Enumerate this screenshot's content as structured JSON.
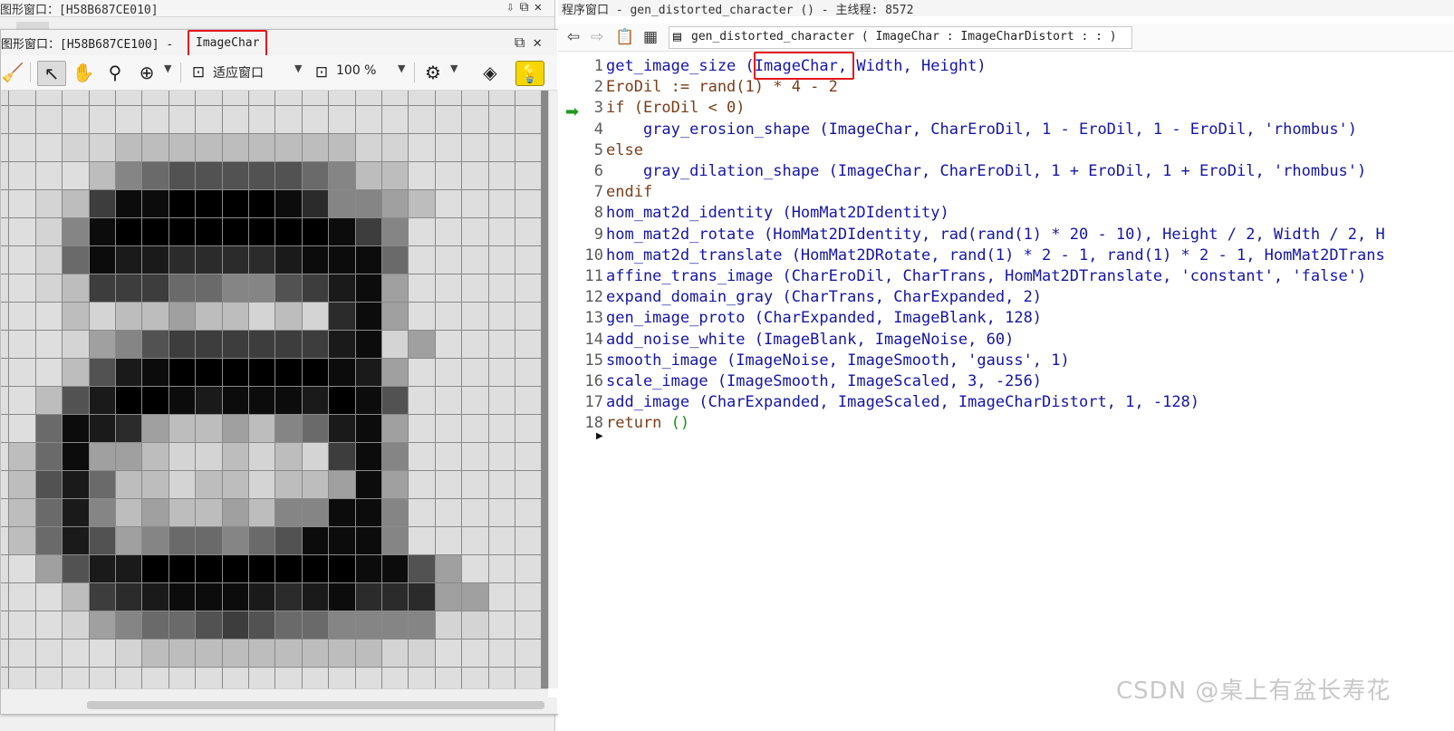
{
  "background_window": {
    "title": "图形窗口：[H58B687CE010]",
    "controls": [
      "⇩",
      "⧉",
      "✕"
    ]
  },
  "graphics_window": {
    "title_prefix": "图形窗口：[H58B687CE100] -",
    "image_name": "ImageChar",
    "zoom_fit_label": "适应窗口",
    "zoom_percent": "100 %",
    "controls": [
      "⧉",
      "✕"
    ]
  },
  "pixel_image": {
    "rows": 22,
    "cols": 21,
    "palette": [
      "#000000",
      "#0c0c0c",
      "#1a1a1a",
      "#2b2b2b",
      "#3d3d3d",
      "#525252",
      "#6a6a6a",
      "#858585",
      "#a0a0a0",
      "#bdbdbd",
      "#d4d4d4",
      "#dedede"
    ],
    "gray": [
      "bbbbbbbbbbbbbbbbbbbbb",
      "bbbbbbbbbbbbbbbbbbbbb",
      "bbbaa999999999aabbbbb",
      "bbbb976555556799bbbbb",
      "bba94110000137789bbbb",
      "bba7100000000147bbbbb",
      "bba6122333321116bbbbb",
      "bba9444667754218bbbbb",
      "bbb9a99899a9a318bbbbb",
      "bbba87544444421a8bbbb",
      "bbb9521000000128bbbbb",
      "bb95200121112015bbbbb",
      "bb61238998976218bbbbb",
      "b961889aa9a9a417bbbbb",
      "b952699a99a99818bbbbb",
      "b962798998977117bbbbb",
      "b962587667651117bbbbb",
      "bb8522000000001158bbb",
      "bbb9432111232133388bb",
      "bbba8766545667777aabb",
      "bbbbba999999999aabbbb",
      "bbbbbbbbbbbbbbbbbbbbb"
    ]
  },
  "program_window": {
    "title": "程序窗口 - gen_distorted_character () - 主线程: 8572",
    "procedure_signature": "gen_distorted_character ( ImageChar : ImageCharDistort : : )",
    "lines": [
      {
        "n": "1",
        "text": "get_image_size (ImageChar, Width, Height)",
        "color": "blue"
      },
      {
        "n": "2",
        "text": "EroDil := rand(1) * 4 - 2",
        "color": "brown"
      },
      {
        "n": "3",
        "text": "if (EroDil < 0)",
        "color": "brown"
      },
      {
        "n": "4",
        "text": "    gray_erosion_shape (ImageChar, CharEroDil, 1 - EroDil, 1 - EroDil, 'rhombus')",
        "color": "blue"
      },
      {
        "n": "5",
        "text": "else",
        "color": "brown"
      },
      {
        "n": "6",
        "text": "    gray_dilation_shape (ImageChar, CharEroDil, 1 + EroDil, 1 + EroDil, 'rhombus')",
        "color": "blue"
      },
      {
        "n": "7",
        "text": "endif",
        "color": "brown"
      },
      {
        "n": "8",
        "text": "hom_mat2d_identity (HomMat2DIdentity)",
        "color": "blue"
      },
      {
        "n": "9",
        "text": "hom_mat2d_rotate (HomMat2DIdentity, rad(rand(1) * 20 - 10), Height / 2, Width / 2, H",
        "color": "blue"
      },
      {
        "n": "10",
        "text": "hom_mat2d_translate (HomMat2DRotate, rand(1) * 2 - 1, rand(1) * 2 - 1, HomMat2DTrans",
        "color": "blue"
      },
      {
        "n": "11",
        "text": "affine_trans_image (CharEroDil, CharTrans, HomMat2DTranslate, 'constant', 'false')",
        "color": "blue"
      },
      {
        "n": "12",
        "text": "expand_domain_gray (CharTrans, CharExpanded, 2)",
        "color": "blue"
      },
      {
        "n": "13",
        "text": "gen_image_proto (CharExpanded, ImageBlank, 128)",
        "color": "blue"
      },
      {
        "n": "14",
        "text": "add_noise_white (ImageBlank, ImageNoise, 60)",
        "color": "blue"
      },
      {
        "n": "15",
        "text": "smooth_image (ImageNoise, ImageSmooth, 'gauss', 1)",
        "color": "blue"
      },
      {
        "n": "16",
        "text": "scale_image (ImageSmooth, ImageScaled, 3, -256)",
        "color": "blue"
      },
      {
        "n": "17",
        "text": "add_image (CharExpanded, ImageScaled, ImageCharDistort, 1, -128)",
        "color": "blue"
      },
      {
        "n": "18",
        "text": "return ()",
        "color": "brown"
      }
    ],
    "current_line": "3"
  },
  "watermark": "CSDN @桌上有盆长寿花",
  "colors": {
    "highlight_red": "#e4161b",
    "code_blue": "#1515a6",
    "code_brown": "#7a3e1a",
    "pc_arrow_green": "#1f9a1f",
    "hint_bulb_yellow": "#f7d600"
  }
}
